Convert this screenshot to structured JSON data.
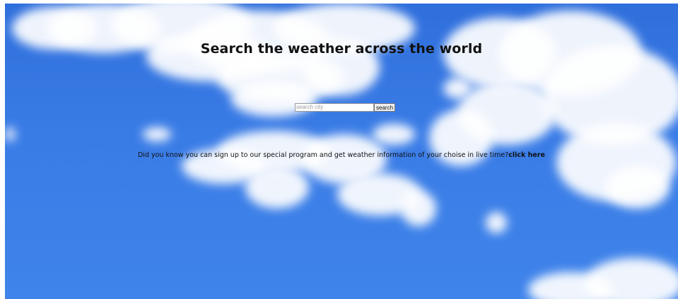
{
  "page": {
    "headline": "Search the weather across the world"
  },
  "search": {
    "placeholder": "search city",
    "value": "",
    "button_label": "search"
  },
  "promo": {
    "text": "Did you know you can sign up to our special program and get weather information of your choise in live time?",
    "link_label": "click here"
  },
  "colors": {
    "sky": "#3a7ce6",
    "cloud": "#ffffff",
    "text": "#111111"
  }
}
